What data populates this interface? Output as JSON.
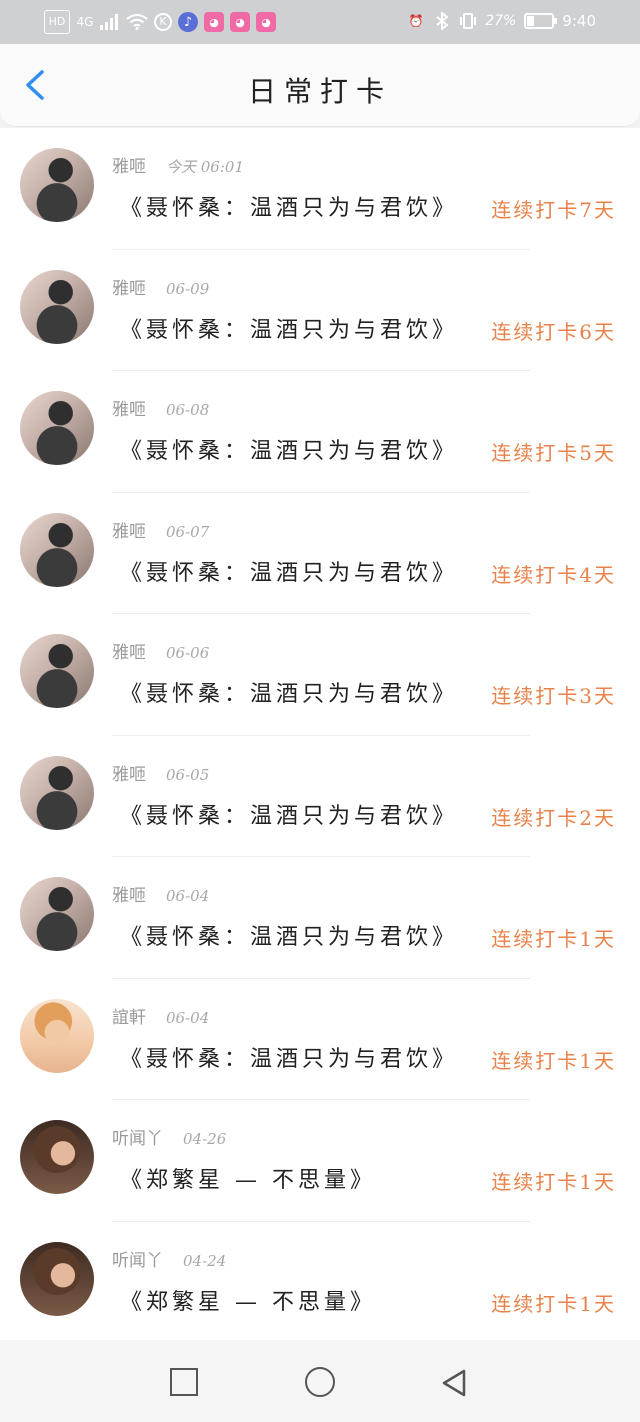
{
  "status_bar": {
    "left": [
      "HD",
      "4G",
      "signal-icon",
      "wifi-icon",
      "K",
      "music-icon",
      "app-icon",
      "app-icon",
      "app-icon"
    ],
    "right_battery": "27%",
    "time": "9:40",
    "battery_level": 0.27
  },
  "header": {
    "title": "日常打卡"
  },
  "rows": [
    {
      "user": "雅咂",
      "date": "今天 06:01",
      "song": "《聂怀桑：温酒只为与君饮》",
      "streak": "连续打卡7天",
      "avatar": "a"
    },
    {
      "user": "雅咂",
      "date": "06-09",
      "song": "《聂怀桑：温酒只为与君饮》",
      "streak": "连续打卡6天",
      "avatar": "a"
    },
    {
      "user": "雅咂",
      "date": "06-08",
      "song": "《聂怀桑：温酒只为与君饮》",
      "streak": "连续打卡5天",
      "avatar": "a"
    },
    {
      "user": "雅咂",
      "date": "06-07",
      "song": "《聂怀桑：温酒只为与君饮》",
      "streak": "连续打卡4天",
      "avatar": "a"
    },
    {
      "user": "雅咂",
      "date": "06-06",
      "song": "《聂怀桑：温酒只为与君饮》",
      "streak": "连续打卡3天",
      "avatar": "a"
    },
    {
      "user": "雅咂",
      "date": "06-05",
      "song": "《聂怀桑：温酒只为与君饮》",
      "streak": "连续打卡2天",
      "avatar": "a"
    },
    {
      "user": "雅咂",
      "date": "06-04",
      "song": "《聂怀桑：温酒只为与君饮》",
      "streak": "连续打卡1天",
      "avatar": "a"
    },
    {
      "user": "誼軒",
      "date": "06-04",
      "song": "《聂怀桑：温酒只为与君饮》",
      "streak": "连续打卡1天",
      "avatar": "b"
    },
    {
      "user": "听闻丫",
      "date": "04-26",
      "song": "《郑繁星 — 不思量》",
      "streak": "连续打卡1天",
      "avatar": "c"
    },
    {
      "user": "听闻丫",
      "date": "04-24",
      "song": "《郑繁星 — 不思量》",
      "streak": "连续打卡1天",
      "avatar": "c"
    }
  ],
  "colors": {
    "accent": "#e8824a",
    "back_arrow": "#2f8ef0"
  }
}
